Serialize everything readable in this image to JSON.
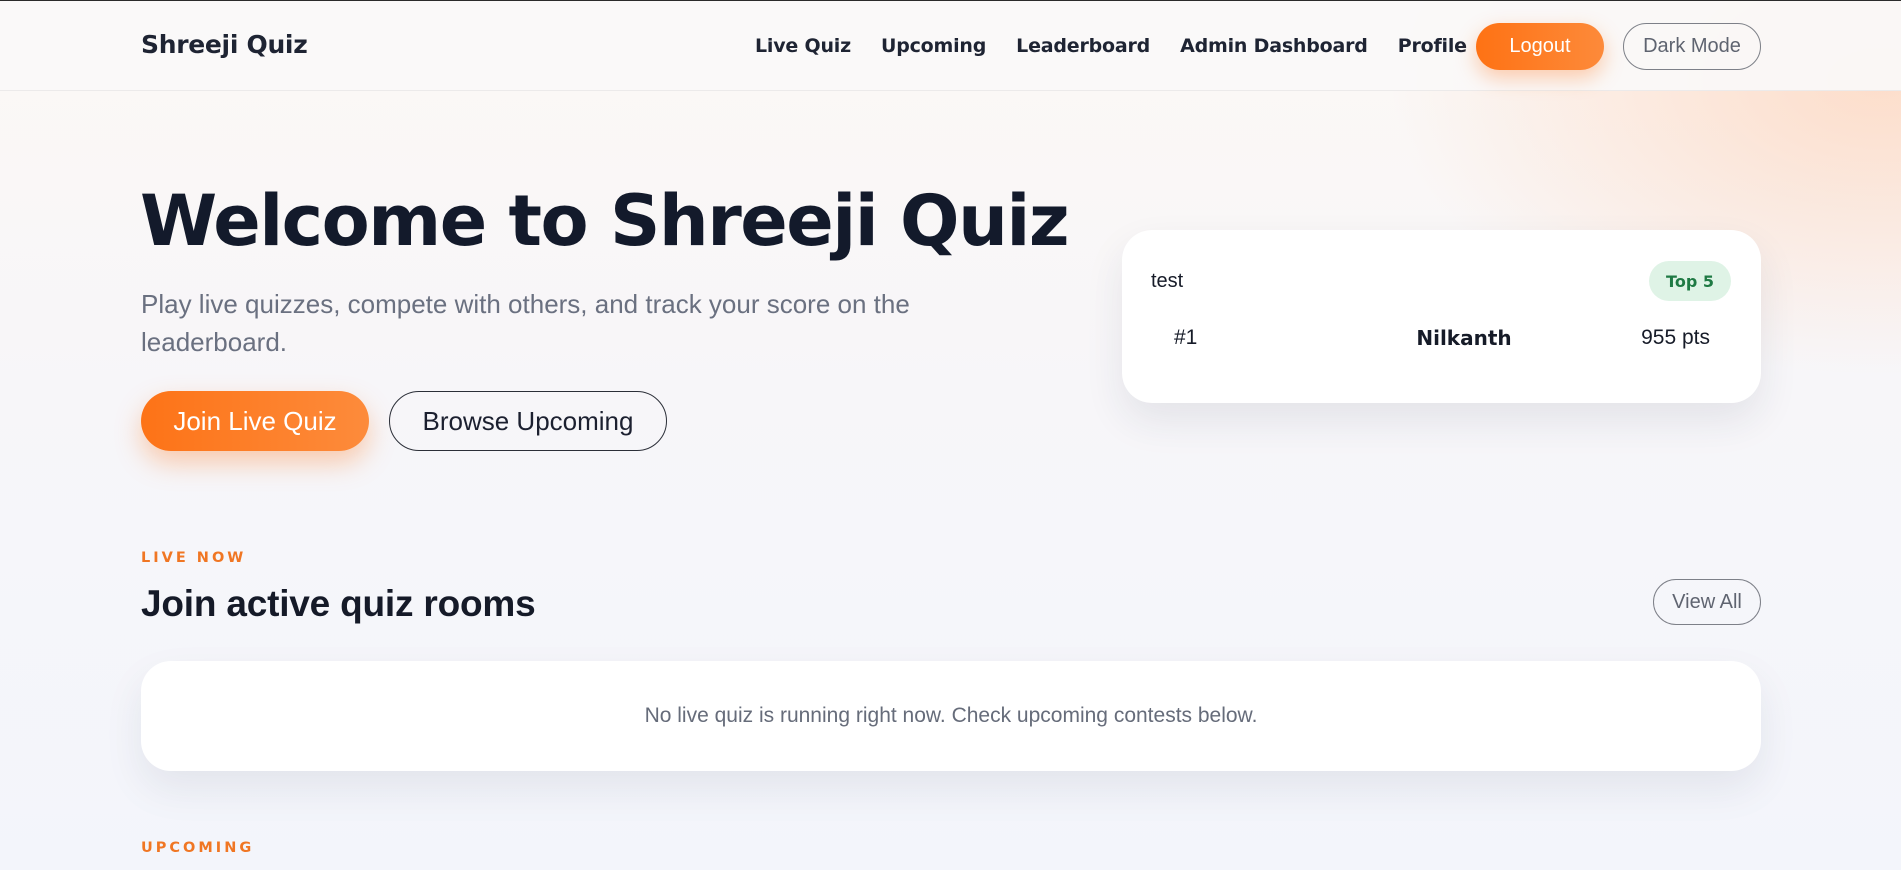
{
  "navbar": {
    "brand": "Shreeji Quiz",
    "links": [
      {
        "label": "Live Quiz"
      },
      {
        "label": "Upcoming"
      },
      {
        "label": "Leaderboard"
      },
      {
        "label": "Admin Dashboard"
      },
      {
        "label": "Profile"
      }
    ],
    "logout_label": "Logout",
    "dark_mode_label": "Dark Mode"
  },
  "hero": {
    "title": "Welcome to Shreeji Quiz",
    "subtitle": "Play live quizzes, compete with others, and track your score on the leaderboard.",
    "primary_button": "Join Live Quiz",
    "secondary_button": "Browse Upcoming"
  },
  "leaderboard_card": {
    "title": "test",
    "badge": "Top 5",
    "rows": [
      {
        "rank": "#1",
        "name": "Nilkanth",
        "points": "955 pts"
      }
    ]
  },
  "live_section": {
    "eyebrow": "LIVE NOW",
    "title": "Join active quiz rooms",
    "view_all_label": "View All",
    "empty_message": "No live quiz is running right now. Check upcoming contests below."
  },
  "upcoming_section": {
    "eyebrow": "UPCOMING"
  },
  "colors": {
    "accent": "#fd7317",
    "badge_bg": "#dff3e6",
    "badge_text": "#1f7a44",
    "heading": "#131a2b",
    "muted": "#6a7080"
  }
}
